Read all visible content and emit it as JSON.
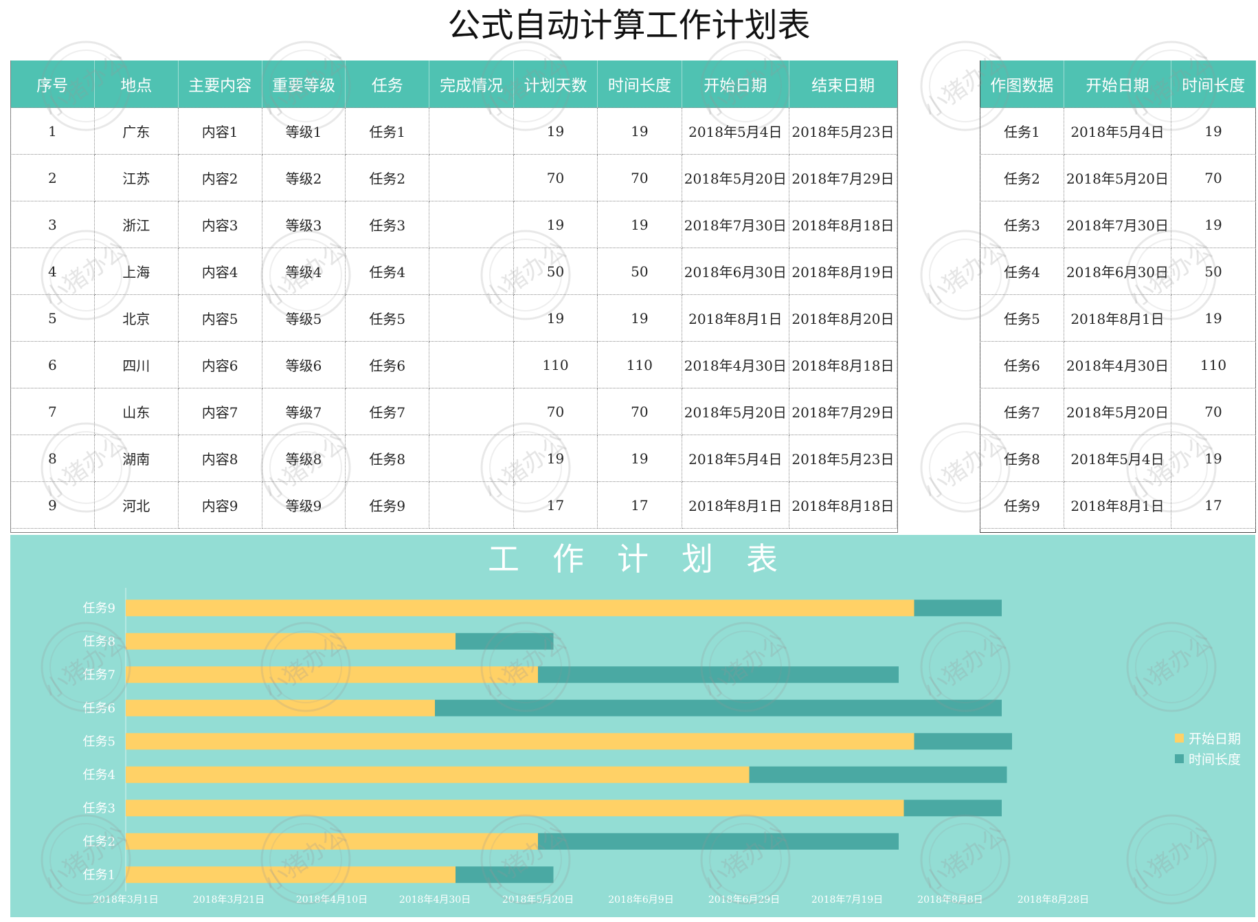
{
  "title": "公式自动计算工作计划表",
  "main_table": {
    "headers": [
      "序号",
      "地点",
      "主要内容",
      "重要等级",
      "任务",
      "完成情况",
      "计划天数",
      "时间长度",
      "开始日期",
      "结束日期"
    ],
    "rows": [
      [
        "1",
        "广东",
        "内容1",
        "等级1",
        "任务1",
        "",
        "19",
        "19",
        "2018年5月4日",
        "2018年5月23日"
      ],
      [
        "2",
        "江苏",
        "内容2",
        "等级2",
        "任务2",
        "",
        "70",
        "70",
        "2018年5月20日",
        "2018年7月29日"
      ],
      [
        "3",
        "浙江",
        "内容3",
        "等级3",
        "任务3",
        "",
        "19",
        "19",
        "2018年7月30日",
        "2018年8月18日"
      ],
      [
        "4",
        "上海",
        "内容4",
        "等级4",
        "任务4",
        "",
        "50",
        "50",
        "2018年6月30日",
        "2018年8月19日"
      ],
      [
        "5",
        "北京",
        "内容5",
        "等级5",
        "任务5",
        "",
        "19",
        "19",
        "2018年8月1日",
        "2018年8月20日"
      ],
      [
        "6",
        "四川",
        "内容6",
        "等级6",
        "任务6",
        "",
        "110",
        "110",
        "2018年4月30日",
        "2018年8月18日"
      ],
      [
        "7",
        "山东",
        "内容7",
        "等级7",
        "任务7",
        "",
        "70",
        "70",
        "2018年5月20日",
        "2018年7月29日"
      ],
      [
        "8",
        "湖南",
        "内容8",
        "等级8",
        "任务8",
        "",
        "19",
        "19",
        "2018年5月4日",
        "2018年5月23日"
      ],
      [
        "9",
        "河北",
        "内容9",
        "等级9",
        "任务9",
        "",
        "17",
        "17",
        "2018年8月1日",
        "2018年8月18日"
      ]
    ]
  },
  "side_table": {
    "headers": [
      "作图数据",
      "开始日期",
      "时间长度"
    ],
    "rows": [
      [
        "任务1",
        "2018年5月4日",
        "19"
      ],
      [
        "任务2",
        "2018年5月20日",
        "70"
      ],
      [
        "任务3",
        "2018年7月30日",
        "19"
      ],
      [
        "任务4",
        "2018年6月30日",
        "50"
      ],
      [
        "任务5",
        "2018年8月1日",
        "19"
      ],
      [
        "任务6",
        "2018年4月30日",
        "110"
      ],
      [
        "任务7",
        "2018年5月20日",
        "70"
      ],
      [
        "任务8",
        "2018年5月4日",
        "19"
      ],
      [
        "任务9",
        "2018年8月1日",
        "17"
      ]
    ]
  },
  "watermark": {
    "text": "小猪办公"
  },
  "chart_data": {
    "type": "bar",
    "orientation": "horizontal",
    "stacked": true,
    "title": "工作计划表",
    "categories": [
      "任务1",
      "任务2",
      "任务3",
      "任务4",
      "任务5",
      "任务6",
      "任务7",
      "任务8",
      "任务9"
    ],
    "series": [
      {
        "name": "开始日期",
        "color": "#ffd166",
        "values": [
          "2018-05-04",
          "2018-05-20",
          "2018-07-30",
          "2018-06-30",
          "2018-08-01",
          "2018-04-30",
          "2018-05-20",
          "2018-05-04",
          "2018-08-01"
        ]
      },
      {
        "name": "时间长度",
        "color": "#4aa9a3",
        "values": [
          19,
          70,
          19,
          50,
          19,
          110,
          70,
          19,
          17
        ]
      }
    ],
    "xlim": [
      "2018-03-01",
      "2018-09-07"
    ],
    "x_ticks": [
      "2018年3月1日",
      "2018年3月21日",
      "2018年4月10日",
      "2018年4月30日",
      "2018年5月20日",
      "2018年6月9日",
      "2018年6月29日",
      "2018年7月19日",
      "2018年8月8日",
      "2018年8月28日"
    ],
    "legend": "right",
    "grid": false
  }
}
